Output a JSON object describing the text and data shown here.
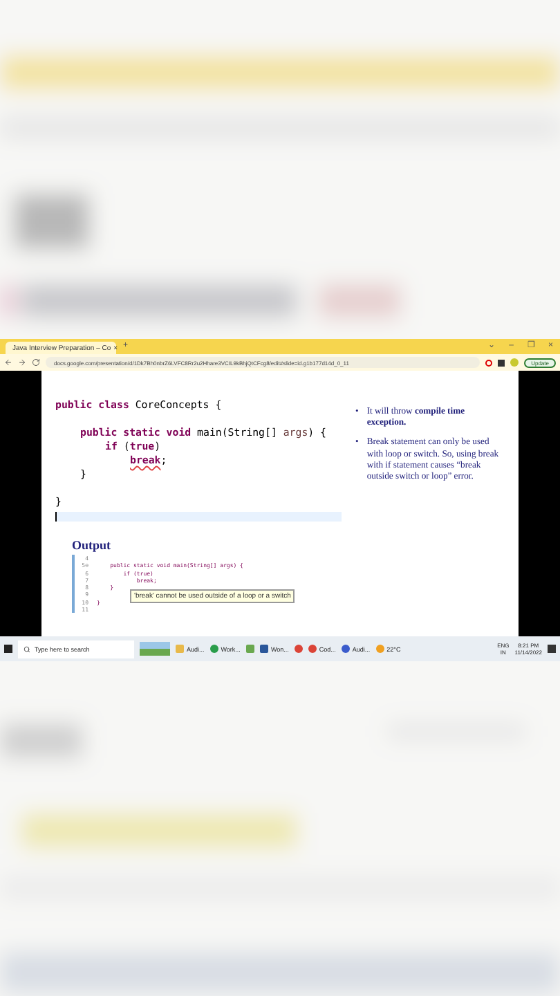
{
  "browser": {
    "tab": {
      "title": "Java Interview Preparation – Co",
      "close": "×"
    },
    "new_tab": "+",
    "window_controls": [
      "⌄",
      "–",
      "❐",
      "×"
    ],
    "address": "docs.google.com/presentation/d/1Dk7Bh0nbrZ6LVFC8Rr2u2Hhare3VCIL9kBhjQtCFcg8/edit#slide=id.g1b177d14d_0_11",
    "update": "Update"
  },
  "slide": {
    "code": [
      {
        "kind": "code",
        "tokens": [
          {
            "text": "public class",
            "kind": "keyword"
          },
          {
            "text": " CoreConcepts {",
            "kind": "plain"
          }
        ],
        "children": [
          {
            "kind": "blank"
          },
          {
            "kind": "code",
            "tokens": [
              {
                "text": "public static void",
                "kind": "keyword"
              },
              {
                "text": " main(String[] ",
                "kind": "plain"
              },
              {
                "text": "args",
                "kind": "param"
              },
              {
                "text": ") {",
                "kind": "plain"
              }
            ],
            "children": [
              {
                "kind": "code",
                "tokens": [
                  {
                    "text": "if",
                    "kind": "keyword"
                  },
                  {
                    "text": " (",
                    "kind": "plain"
                  },
                  {
                    "text": "true",
                    "kind": "keyword"
                  },
                  {
                    "text": ")",
                    "kind": "plain"
                  }
                ],
                "children": [
                  {
                    "kind": "code",
                    "tokens": [
                      {
                        "text": "break",
                        "kind": "error"
                      },
                      {
                        "text": ";",
                        "kind": "plain"
                      }
                    ]
                  }
                ]
              }
            ]
          },
          {
            "kind": "code",
            "tokens": [
              {
                "text": "}",
                "kind": "plain"
              }
            ]
          },
          {
            "kind": "blank"
          }
        ]
      },
      {
        "kind": "code",
        "tokens": [
          {
            "text": "}",
            "kind": "plain"
          }
        ]
      }
    ],
    "bullets": [
      {
        "marker": "•",
        "text": "It will throw **compile time exception.**"
      },
      {
        "marker": "•",
        "text": "Break statement can only be used with loop or switch. So, using break with if statement causes “break outside switch or loop” error."
      }
    ],
    "output_title": "Output",
    "output": {
      "lines": [
        {
          "num": "4"
        },
        {
          "num": "5⊖",
          "code": "    public static void main(String[] args) {"
        },
        {
          "num": "6",
          "code": "        if (true)"
        },
        {
          "num": "7",
          "code": "            break;"
        },
        {
          "num": "8",
          "code": "    }"
        },
        {
          "num": "9"
        },
        {
          "num": "10",
          "code": "}"
        },
        {
          "num": "11"
        }
      ],
      "tooltip": "'break' cannot be used outside of a loop or a switch"
    }
  },
  "taskbar": {
    "search": "Type here to search",
    "apps": [
      {
        "kind": "folder",
        "label": "Audi..."
      },
      {
        "kind": "round",
        "label": "Work..."
      },
      {
        "kind": "square"
      },
      {
        "kind": "word",
        "label": "Won..."
      },
      {
        "kind": "chrome"
      },
      {
        "kind": "chrome",
        "label": "Cod..."
      },
      {
        "kind": "headset",
        "label": "Audi..."
      }
    ],
    "weather": "22°C",
    "lang": [
      "ENG",
      "IN"
    ],
    "time": "8:21 PM",
    "date": "11/14/2022"
  }
}
